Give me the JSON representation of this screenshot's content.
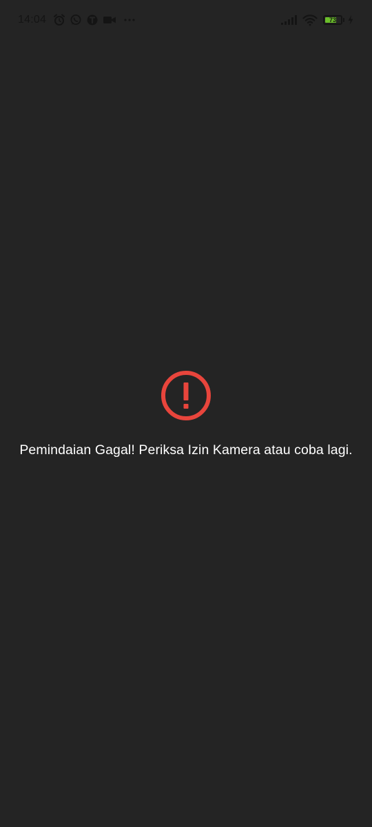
{
  "status_bar": {
    "time": "14:04",
    "left_icons": [
      "alarm-icon",
      "whatsapp-icon",
      "app-notification-icon",
      "video-camera-icon",
      "more-notifications-icon"
    ],
    "right_icons": [
      "signal-icon",
      "wifi-icon",
      "battery-icon",
      "charging-icon"
    ],
    "battery_level": "73",
    "battery_fraction": 0.73,
    "battery_color": "#6bbf2a"
  },
  "error": {
    "icon": "error-icon",
    "icon_color": "#e8453c",
    "message": "Pemindaian Gagal! Periksa Izin Kamera atau coba lagi."
  },
  "colors": {
    "background": "#242424",
    "text": "#ffffff"
  }
}
